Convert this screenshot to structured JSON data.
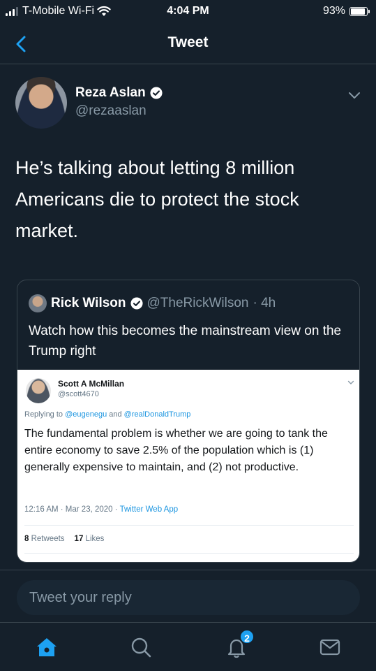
{
  "status_bar": {
    "carrier": "T-Mobile Wi-Fi",
    "time": "4:04 PM",
    "battery": "93%"
  },
  "header": {
    "title": "Tweet"
  },
  "tweet": {
    "author_name": "Reza Aslan",
    "author_handle": "@rezaaslan",
    "text": "He’s talking about letting 8 million Americans die to protect the stock market."
  },
  "quoted_tweet": {
    "author_name": "Rick Wilson",
    "author_handle": "@TheRickWilson",
    "time_ago": "· 4h",
    "text": "Watch how this becomes the mainstream view on the Trump right"
  },
  "screenshot_tweet": {
    "author_name": "Scott A McMillan",
    "author_handle": "@scott4670",
    "replying_prefix": "Replying to ",
    "replying_to_1": "@eugenegu",
    "replying_and": " and ",
    "replying_to_2": "@realDonaldTrump",
    "text": "The fundamental problem is whether we are going to tank the entire economy to save 2.5% of the population which is (1) generally expensive to maintain, and (2) not productive.",
    "meta_time": "12:16 AM · Mar 23, 2020 · ",
    "meta_source": "Twitter Web App",
    "retweets_count": "8",
    "retweets_label": "Retweets",
    "likes_count": "17",
    "likes_label": "Likes"
  },
  "reply": {
    "placeholder": "Tweet your reply"
  },
  "tab_bar": {
    "items": [
      {
        "icon": "home-icon",
        "active": true
      },
      {
        "icon": "search-icon",
        "active": false
      },
      {
        "icon": "notifications-icon",
        "active": false,
        "badge": "2"
      },
      {
        "icon": "messages-icon",
        "active": false
      }
    ]
  },
  "colors": {
    "background": "#15202b",
    "accent": "#1da1f2",
    "secondary_text": "#8899a6",
    "border": "#38444d"
  }
}
